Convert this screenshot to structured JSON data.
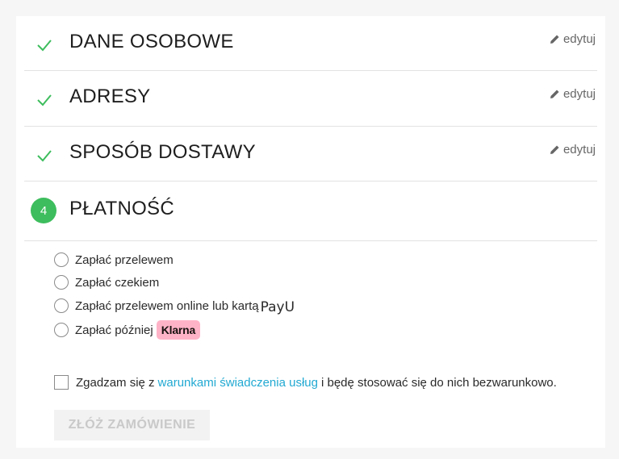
{
  "steps": [
    {
      "title": "DANE OSOBOWE",
      "edit_label": "edytuj",
      "status": "done"
    },
    {
      "title": "ADRESY",
      "edit_label": "edytuj",
      "status": "done"
    },
    {
      "title": "SPOSÓB DOSTAWY",
      "edit_label": "edytuj",
      "status": "done"
    },
    {
      "title": "PŁATNOŚĆ",
      "number": "4",
      "status": "active"
    }
  ],
  "payment_options": [
    {
      "label": "Zapłać przelewem"
    },
    {
      "label": "Zapłać czekiem"
    },
    {
      "label": "Zapłać przelewem online lub kartą",
      "logo_text": "PayU"
    },
    {
      "label": "Zapłać później",
      "badge": "Klarna"
    }
  ],
  "terms": {
    "prefix": "Zgadzam się z",
    "link": "warunkami świadczenia usług",
    "suffix": "i będę stosować się do nich bezwarunkowo."
  },
  "submit_label": "ZŁÓŻ ZAMÓWIENIE",
  "colors": {
    "accent_green": "#3dbd5d",
    "link": "#22a9d2",
    "klarna_pink": "#ffb3c7"
  }
}
